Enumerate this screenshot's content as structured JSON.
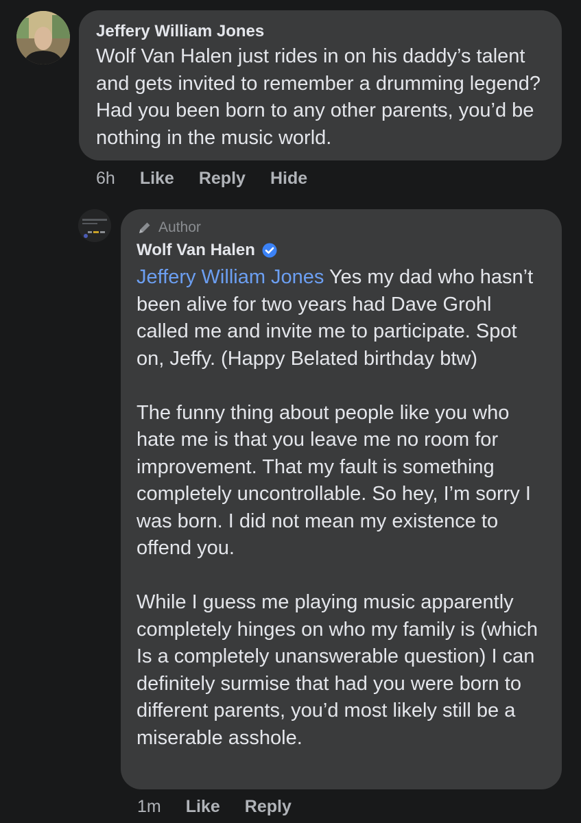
{
  "comment": {
    "author": "Jeffery William Jones",
    "text": "Wolf Van Halen just rides in on his daddy’s talent and gets invited to remember a drumming legend? Had you been born to any other parents, you’d be nothing in the music world.",
    "time": "6h",
    "like_label": "Like",
    "reply_label": "Reply",
    "hide_label": "Hide",
    "avatar_icon": "person-avatar"
  },
  "reply": {
    "badge": "Author",
    "badge_icon": "pencil-icon",
    "author": "Wolf Van Halen",
    "verified_icon": "verified-badge-icon",
    "mention": "Jeffery William Jones",
    "text_p1": " Yes my dad who hasn’t been alive for two years had Dave Grohl called me and invite me to participate. Spot on, Jeffy. (Happy Belated birthday btw)",
    "text_p2": "The funny thing about people like you who hate me is that you leave me no room for improvement. That my fault is something completely uncontrollable. So hey, I’m sorry I was born. I did not mean my existence to offend you.",
    "text_p3": "While I guess me playing music apparently completely hinges on who my family is (which Is a completely unanswerable question) I can definitely surmise that had you were born to different parents, you’d most likely still be a miserable asshole.",
    "time": "1m",
    "like_label": "Like",
    "reply_label": "Reply"
  },
  "colors": {
    "background": "#18191a",
    "bubble": "#3a3b3c",
    "text": "#e4e6eb",
    "secondary": "#b0b3b8",
    "mention": "#6c9ff2",
    "verified": "#3b82f6"
  }
}
